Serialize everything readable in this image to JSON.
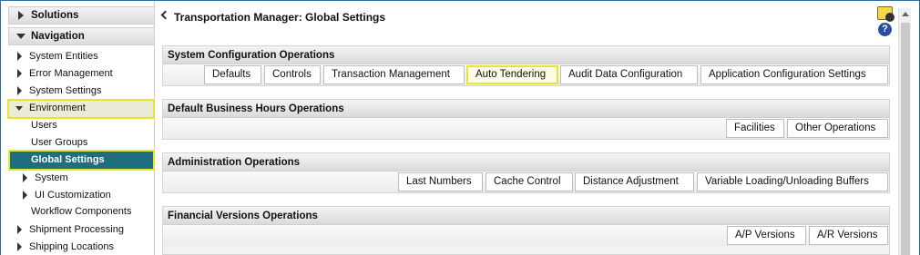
{
  "sidebar": {
    "solutions": "Solutions",
    "navigation": "Navigation",
    "items": {
      "system_entities": "System Entities",
      "error_management": "Error Management",
      "system_settings": "System Settings",
      "environment": "Environment",
      "users": "Users",
      "user_groups": "User Groups",
      "global_settings": "Global Settings",
      "system": "System",
      "ui_customization": "UI Customization",
      "workflow_components": "Workflow Components",
      "shipment_processing": "Shipment Processing",
      "shipping_locations": "Shipping Locations"
    }
  },
  "header": {
    "title": "Transportation Manager: Global Settings"
  },
  "sections": {
    "system_config": {
      "title": "System Configuration Operations",
      "buttons": [
        "Defaults",
        "Controls",
        "Transaction Management",
        "Auto Tendering",
        "Audit Data Configuration",
        "Application Configuration Settings"
      ]
    },
    "business_hours": {
      "title": "Default Business Hours Operations",
      "buttons": [
        "Facilities",
        "Other Operations"
      ]
    },
    "administration": {
      "title": "Administration Operations",
      "buttons": [
        "Last Numbers",
        "Cache Control",
        "Distance Adjustment",
        "Variable Loading/Unloading Buffers"
      ]
    },
    "financial": {
      "title": "Financial Versions Operations",
      "buttons": [
        "A/P Versions",
        "A/R Versions"
      ]
    }
  },
  "icons": {
    "config": "settings-config-icon",
    "help": "help-icon",
    "help_glyph": "?"
  },
  "colors": {
    "highlight": "#e6e62a",
    "selected_row": "#1f6e7f",
    "frame": "#2f6f9e"
  }
}
